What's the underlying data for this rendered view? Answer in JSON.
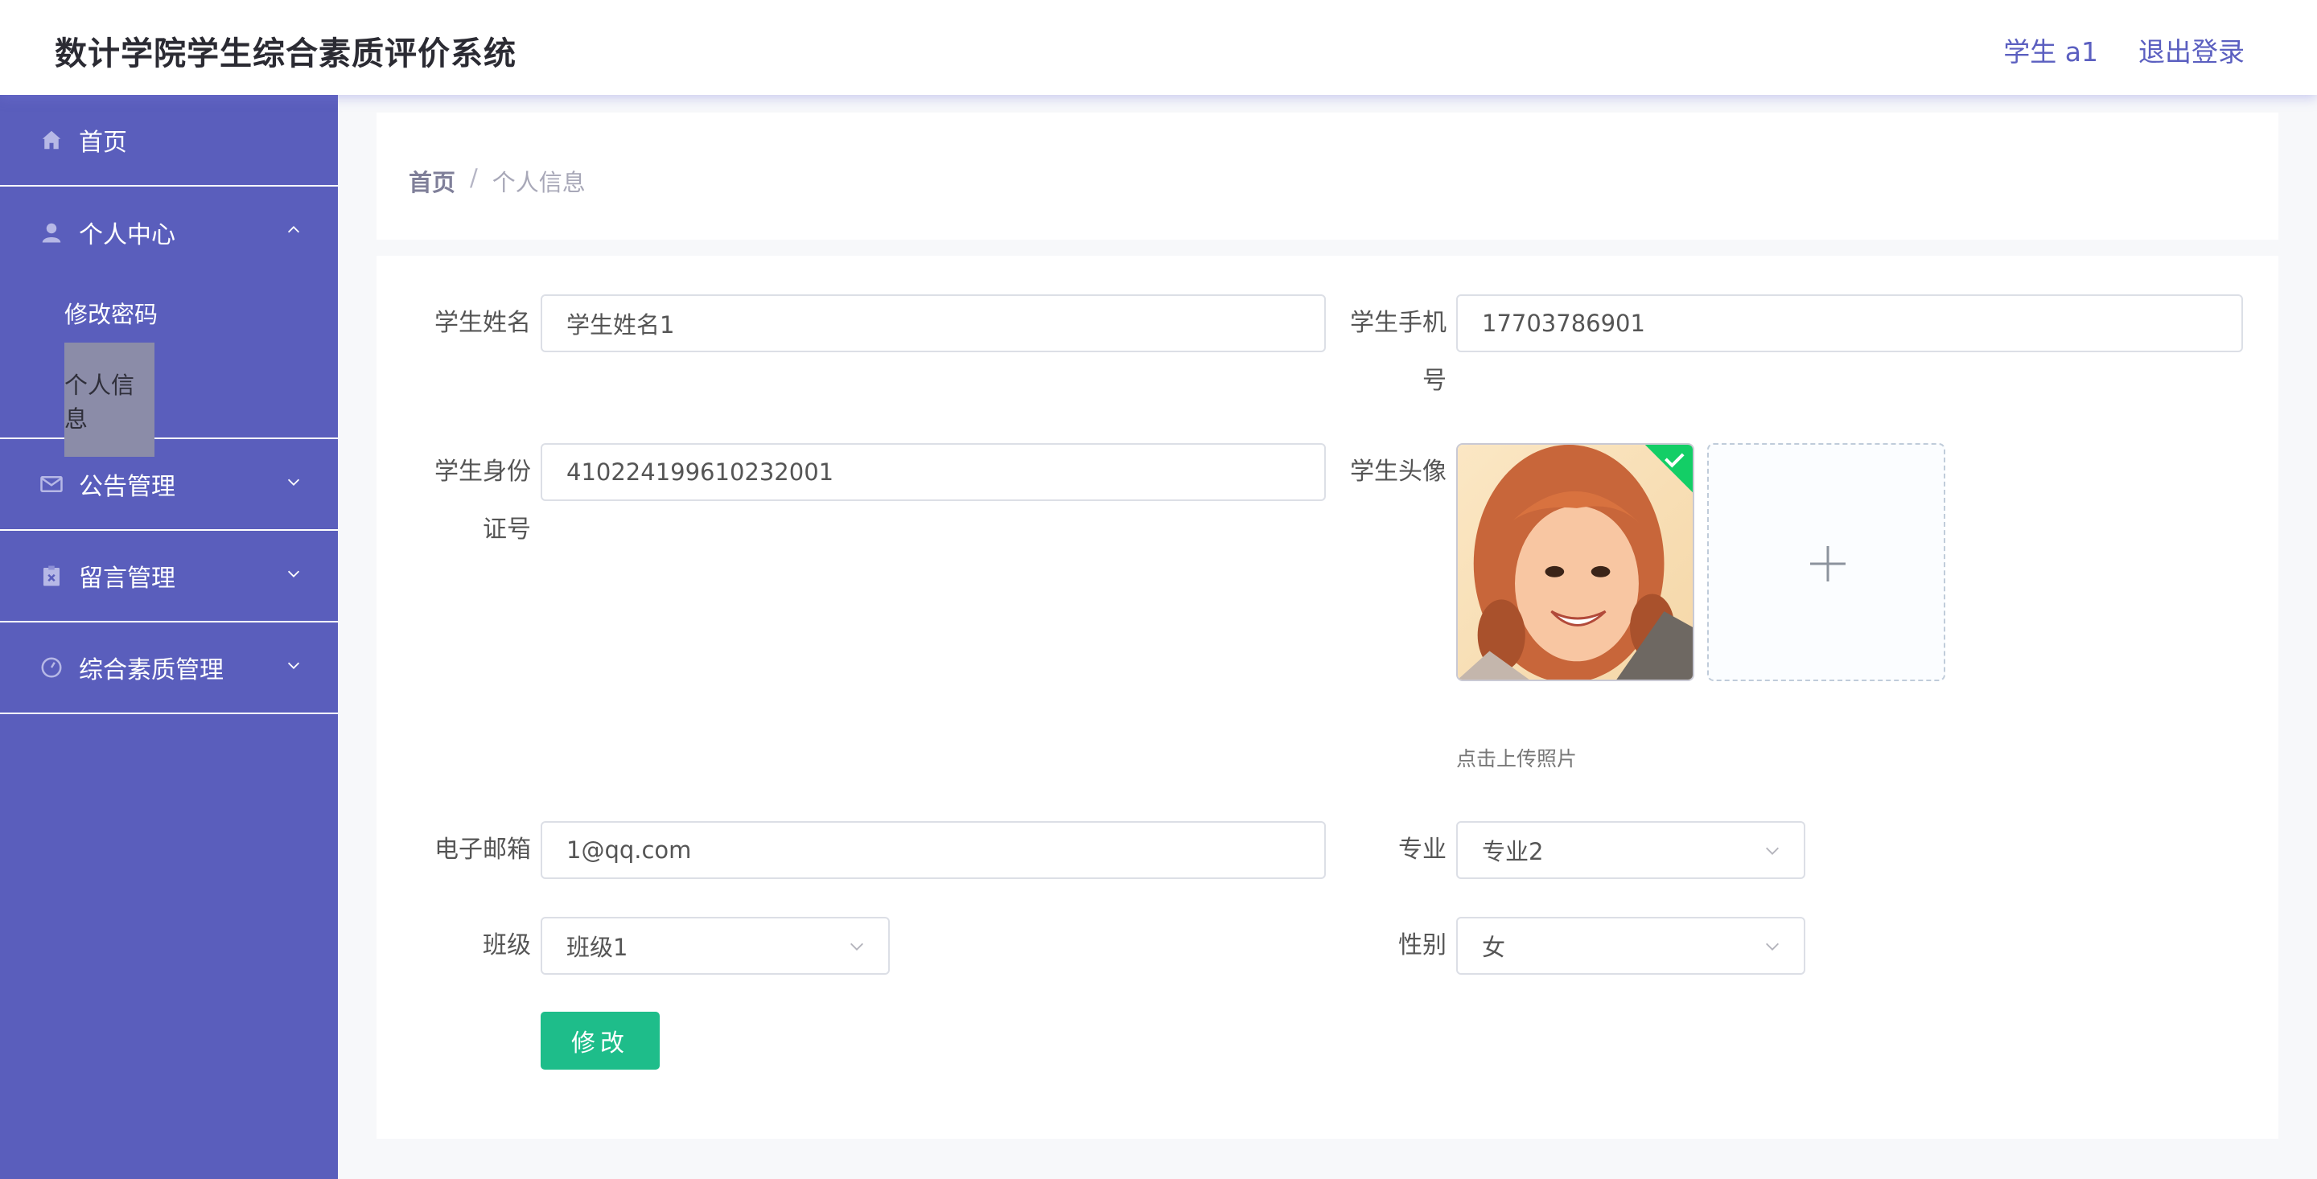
{
  "header": {
    "title": "数计学院学生综合素质评价系统",
    "user": "学生 a1",
    "logout": "退出登录"
  },
  "sidebar": {
    "items": [
      {
        "label": "首页",
        "icon": "home-icon"
      },
      {
        "label": "个人中心",
        "icon": "user-icon",
        "expanded": true,
        "children": [
          {
            "label": "修改密码"
          },
          {
            "label": "个人信息",
            "active": true
          }
        ]
      },
      {
        "label": "公告管理",
        "icon": "mail-icon"
      },
      {
        "label": "留言管理",
        "icon": "clipboard-icon"
      },
      {
        "label": "综合素质管理",
        "icon": "gauge-icon"
      }
    ]
  },
  "breadcrumb": {
    "home": "首页",
    "separator": "/",
    "current": "个人信息"
  },
  "form": {
    "name_label": "学生姓名",
    "name_value": "学生姓名1",
    "phone_label_1": "学生手机",
    "phone_label_2": "号",
    "phone_value": "17703786901",
    "id_label_1": "学生身份",
    "id_label_2": "证号",
    "id_value": "410224199610232001",
    "avatar_label": "学生头像",
    "upload_tip": "点击上传照片",
    "email_label": "电子邮箱",
    "email_value": "1@qq.com",
    "major_label": "专业",
    "major_value": "专业2",
    "class_label": "班级",
    "class_value": "班级1",
    "gender_label": "性别",
    "gender_value": "女",
    "submit_label": "修改"
  },
  "colors": {
    "sidebar": "#5a5ebc",
    "accent": "#5b5fc0",
    "submit": "#1ebd8a",
    "upload_success": "#13ce66"
  }
}
